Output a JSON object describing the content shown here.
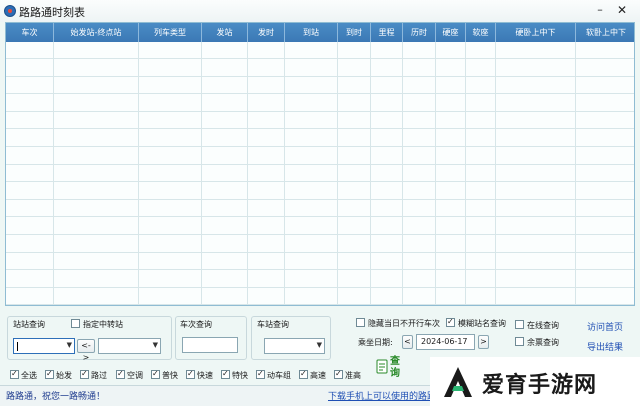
{
  "window": {
    "title": "路路通时刻表",
    "min_glyph": "–",
    "close_glyph": "✕"
  },
  "grid": {
    "columns": [
      "车次",
      "始发站-终点站",
      "列车类型",
      "发站",
      "发时",
      "到站",
      "到时",
      "里程",
      "历时",
      "硬座",
      "软座",
      "硬卧上中下",
      "软卧上中下"
    ]
  },
  "search": {
    "station_query_label": "站站查询",
    "transfer_label": "指定中转站",
    "transfer_checked": false,
    "swap_label": "<->",
    "train_query_label": "车次查询",
    "station_query2_label": "车站查询",
    "hide_label": "隐藏当日不开行车次",
    "hide_checked": false,
    "fuzzy_label": "模糊站名查询",
    "fuzzy_checked": true,
    "online_label": "在线查询",
    "online_checked": false,
    "remain_label": "余票查询",
    "remain_checked": false,
    "date_label": "乘坐日期:",
    "date_value": "2024-06-17",
    "prev_label": "<",
    "next_label": ">",
    "query_label": "查询"
  },
  "filters": [
    {
      "label": "全选",
      "checked": true
    },
    {
      "label": "始发",
      "checked": true
    },
    {
      "label": "路过",
      "checked": true
    },
    {
      "label": "空调",
      "checked": true
    },
    {
      "label": "普快",
      "checked": true
    },
    {
      "label": "快速",
      "checked": true
    },
    {
      "label": "特快",
      "checked": true
    },
    {
      "label": "动车组",
      "checked": true
    },
    {
      "label": "高速",
      "checked": true
    },
    {
      "label": "准高",
      "checked": true
    }
  ],
  "links": {
    "home": "访问首页",
    "export": "导出结果"
  },
  "status": {
    "left": "路路通，祝您一路畅通！",
    "link": "下载手机上可以使用的路路"
  },
  "watermark": {
    "text": "爱育手游网"
  }
}
